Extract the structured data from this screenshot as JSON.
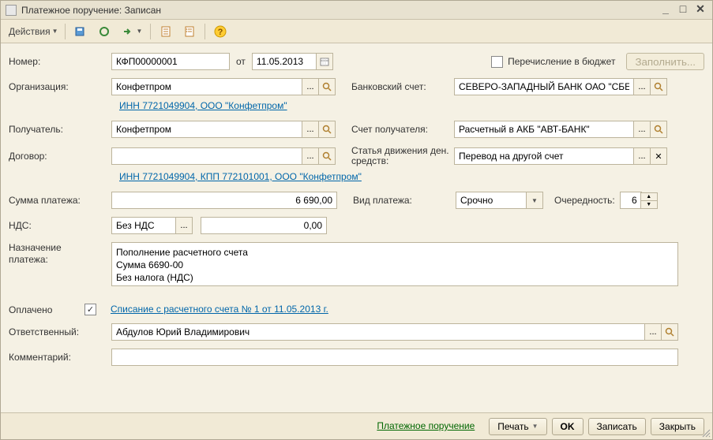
{
  "window": {
    "title": "Платежное поручение: Записан"
  },
  "toolbar": {
    "actions": "Действия"
  },
  "labels": {
    "number": "Номер:",
    "from": "от",
    "organization": "Организация:",
    "bank_account": "Банковский счет:",
    "recipient": "Получатель:",
    "recipient_account": "Счет получателя:",
    "contract": "Договор:",
    "cashflow": "Статья движения ден. средств:",
    "amount": "Сумма платежа:",
    "payment_type": "Вид платежа:",
    "priority": "Очередность:",
    "vat": "НДС:",
    "purpose_l1": "Назначение",
    "purpose_l2": "платежа:",
    "paid": "Оплачено",
    "responsible": "Ответственный:",
    "comment": "Комментарий:",
    "to_budget": "Перечисление в бюджет",
    "fill": "Заполнить..."
  },
  "values": {
    "number": "КФП00000001",
    "date": "11.05.2013",
    "organization": "Конфетпром",
    "org_link": "ИНН 7721049904, ООО \"Конфетпром\"",
    "bank_account": "СЕВЕРО-ЗАПАДНЫЙ БАНК ОАО \"СБЕ",
    "recipient": "Конфетпром",
    "recipient_account": "Расчетный в АКБ \"АВТ-БАНК\"",
    "contract": "",
    "recipient_link": "ИНН 7721049904, КПП 772101001, ООО \"Конфетпром\"",
    "cashflow": "Перевод на другой счет",
    "amount": "6 690,00",
    "payment_type": "Срочно",
    "priority": "6",
    "vat_type": "Без НДС",
    "vat_amount": "0,00",
    "purpose": "Пополнение расчетного счета\nСумма 6690-00\nБез налога (НДС)",
    "paid": true,
    "paid_link": "Списание с расчетного счета № 1 от 11.05.2013 г.",
    "responsible": "Абдулов Юрий Владимирович",
    "comment": ""
  },
  "footer": {
    "payorder": "Платежное поручение",
    "print": "Печать",
    "ok": "OK",
    "save": "Записать",
    "close": "Закрыть"
  }
}
